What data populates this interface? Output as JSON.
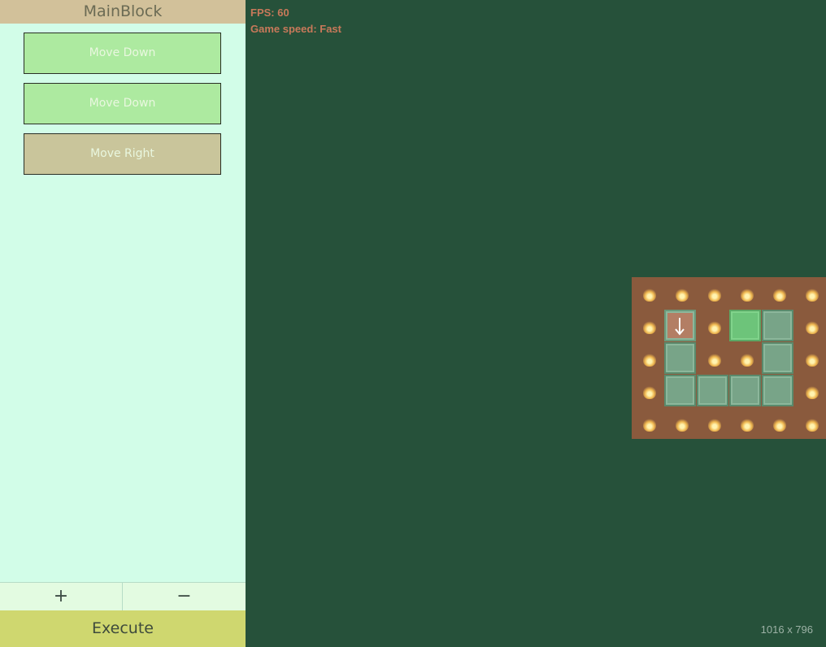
{
  "panel": {
    "title": "MainBlock",
    "commands": [
      {
        "label": "Move Down",
        "state": "green"
      },
      {
        "label": "Move Down",
        "state": "green"
      },
      {
        "label": "Move Right",
        "state": "tan"
      }
    ],
    "add_label": "+",
    "remove_label": "−",
    "execute_label": "Execute"
  },
  "hud": {
    "fps": "FPS: 60",
    "speed": "Game speed: Fast",
    "resolution": "1016 x 796"
  },
  "board": {
    "cols": 6,
    "rows": 5,
    "grid": [
      [
        "fire",
        "fire",
        "fire",
        "fire",
        "fire",
        "fire"
      ],
      [
        "fire",
        "player",
        "fire",
        "goal",
        "path",
        "fire"
      ],
      [
        "fire",
        "path",
        "fire",
        "fire",
        "path",
        "fire"
      ],
      [
        "fire",
        "path",
        "path",
        "path",
        "path",
        "fire"
      ],
      [
        "fire",
        "fire",
        "fire",
        "fire",
        "fire",
        "fire"
      ]
    ],
    "player_direction": "down",
    "colors": {
      "background": "#8a5a3d",
      "path": "#78a488",
      "goal": "#6dc47a",
      "player": "#b37e64"
    }
  }
}
